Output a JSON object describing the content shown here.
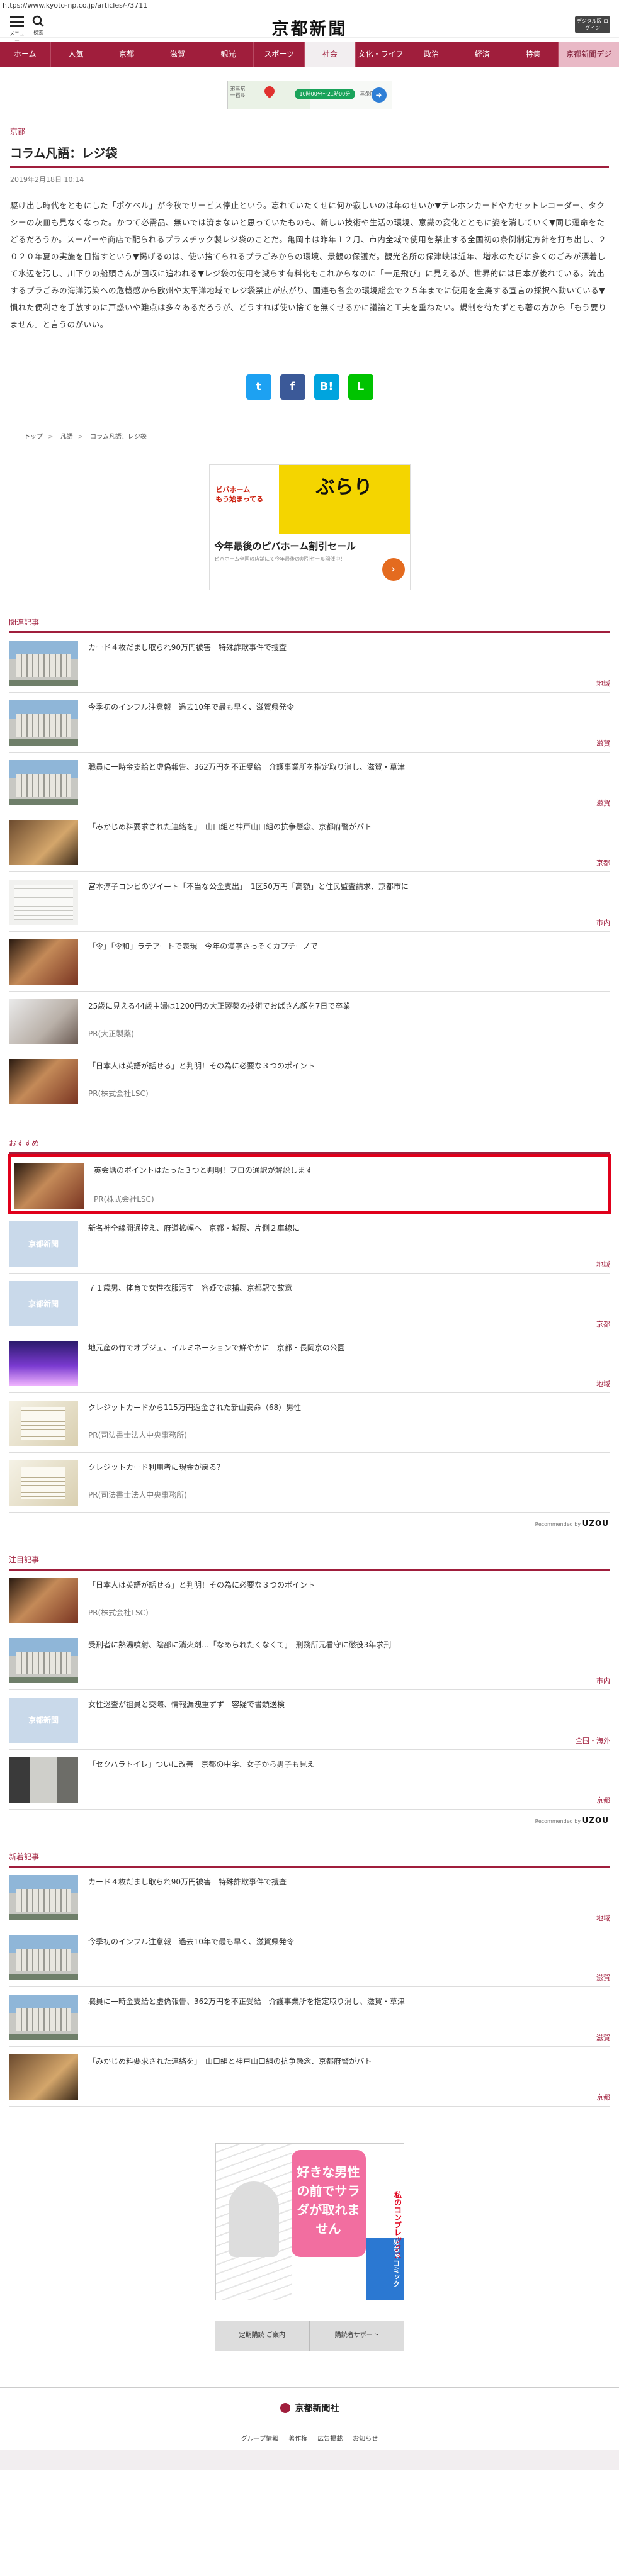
{
  "browser": {
    "url": "https://www.kyoto-np.co.jp/articles/-/3711"
  },
  "header": {
    "menu_label": "メニュー",
    "search_label": "検索",
    "logo": "京都新聞",
    "digital_label": "デジタル版 ログイン"
  },
  "nav": [
    "ホーム",
    "人気",
    "京都",
    "滋賀",
    "観光",
    "スポーツ",
    "社会",
    "文化・ライフ",
    "政治",
    "経済",
    "特集",
    "京都新聞デジ"
  ],
  "nav_active": "社会",
  "top_ad": {
    "map_text": "第三京\n一石ル",
    "pill": "10時00分〜21時00分",
    "dest": "三条店"
  },
  "article": {
    "category": "京都",
    "title": "コラム凡語：レジ袋",
    "date": "2019年2月18日 10:14",
    "body": "駆け出し時代をともにした「ポケベル」が今秋でサービス停止という。忘れていたくせに何か寂しいのは年のせいか▼テレホンカードやカセットレコーダー、タクシーの灰皿も見なくなった。かつて必需品、無いでは済まないと思っていたものも、新しい技術や生活の環境、意識の変化とともに姿を消していく▼同じ運命をたどるだろうか。スーパーや商店で配られるプラスチック製レジ袋のことだ。亀岡市は昨年１２月、市内全域で使用を禁止する全国初の条例制定方針を打ち出し、２０２０年夏の実施を目指すという▼掲げるのは、使い捨てられるプラごみからの環境、景観の保護だ。観光名所の保津峡は近年、増水のたびに多くのごみが漂着して水辺を汚し、川下りの船頭さんが回収に追われる▼レジ袋の使用を減らす有料化もこれからなのに「一足飛び」に見えるが、世界的には日本が後れている。流出するプラごみの海洋汚染への危機感から欧州や太平洋地域でレジ袋禁止が広がり、国連も各会の環境総会で２５年までに使用を全廃する宣言の採択へ動いている▼慣れた便利さを手放すのに戸惑いや難点は多々あるだろうが、どうすれば使い捨てを無くせるかに議論と工夫を重ねたい。規制を待たずとも著の方から「もう要りません」と言うのがいい。"
  },
  "share": [
    "twitter",
    "facebook",
    "hatena",
    "line"
  ],
  "breadcrumb": [
    "トップ",
    "凡語",
    "コラム凡語：レジ袋"
  ],
  "mid_ad": {
    "left": "ピバホーム\nもう始まってる",
    "main": "ぶらり",
    "headline": "今年最後のピバホーム割引セール",
    "sub": "ピバホーム全国の店舗にて今年最後の割引セール開催中！"
  },
  "related": {
    "heading": "関連記事",
    "items": [
      {
        "title": "カード４枚だまし取られ90万円被害　特殊詐欺事件で捜査",
        "sub": "",
        "cat": "地域"
      },
      {
        "title": "今季初のインフル注意報　過去10年で最も早く、滋賀県発令",
        "sub": "",
        "cat": "滋賀"
      },
      {
        "title": "職員に一時金支給と虚偽報告、362万円を不正受給　介護事業所を指定取り消し、滋賀・草津",
        "sub": "",
        "cat": "滋賀"
      },
      {
        "title": "「みかじめ料要求された連絡を」　山口組と神戸山口組の抗争懸念、京都府警がパト",
        "sub": "",
        "cat": "京都"
      },
      {
        "title": "宮本淳子コンビのツイート「不当な公金支出」　1区50万円「高額」と住民監査請求、京都市に",
        "sub": "",
        "cat": "市内"
      },
      {
        "title": "「令」「令和」ラテアートで表現　今年の漢字さっそくカプチーノで",
        "sub": "",
        "cat": ""
      },
      {
        "title": "25歳に見える44歳主婦は1200円の大正製薬の技術でおばさん顔を7日で卒業",
        "sub": "PR(大正製薬)",
        "cat": ""
      },
      {
        "title": "「日本人は英語が話せる」と判明！その為に必要な３つのポイント",
        "sub": "PR(株式会社LSC)",
        "cat": ""
      }
    ]
  },
  "recommend": {
    "heading": "おすすめ",
    "items": [
      {
        "title": "英会話のポイントはたった３つと判明！プロの通訳が解説します",
        "sub": "PR(株式会社LSC)",
        "cat": ""
      },
      {
        "title": "新名神全線開通控え、府道拡幅へ　京都・城陽、片側２車線に",
        "sub": "",
        "cat": "地域"
      },
      {
        "title": "７１歳男、体育で女性衣服汚す　容疑で逮捕、京都駅で故意",
        "sub": "",
        "cat": "京都"
      },
      {
        "title": "地元産の竹でオブジェ、イルミネーションで鮮やかに　京都・長岡京の公園",
        "sub": "",
        "cat": "地域"
      },
      {
        "title": "クレジットカードから115万円返金された新山安命（68）男性",
        "sub": "PR(司法書士法人中央事務所)",
        "cat": ""
      },
      {
        "title": "クレジットカード利用者に現金が戻る？",
        "sub": "PR(司法書士法人中央事務所)",
        "cat": ""
      }
    ],
    "by": "Recommended by",
    "brand": "UZOU"
  },
  "attention": {
    "heading": "注目記事",
    "items": [
      {
        "title": "「日本人は英語が話せる」と判明！その為に必要な３つのポイント",
        "sub": "PR(株式会社LSC)",
        "cat": ""
      },
      {
        "title": "受刑者に熱湯噴射、陰部に消火剤…「なめられたくなくて」　刑務所元看守に懲役3年求刑",
        "sub": "",
        "cat": "市内"
      },
      {
        "title": "女性巡査が祖員と交際、情報漏洩重ずず　容疑で書類送検",
        "sub": "",
        "cat": "全国・海外"
      },
      {
        "title": "「セクハラトイレ」ついに改善　京都の中学、女子から男子も見え",
        "sub": "",
        "cat": "京都"
      }
    ],
    "by": "Recommended by",
    "brand": "UZOU"
  },
  "latest": {
    "heading": "新着記事",
    "items": [
      {
        "title": "カード４枚だまし取られ90万円被害　特殊詐欺事件で捜査",
        "sub": "",
        "cat": "地域"
      },
      {
        "title": "今季初のインフル注意報　過去10年で最も早く、滋賀県発令",
        "sub": "",
        "cat": "滋賀"
      },
      {
        "title": "職員に一時金支給と虚偽報告、362万円を不正受給　介護事業所を指定取り消し、滋賀・草津",
        "sub": "",
        "cat": "滋賀"
      },
      {
        "title": "「みかじめ料要求された連絡を」　山口組と神戸山口組の抗争懸念、京都府警がパト",
        "sub": "",
        "cat": "京都"
      }
    ]
  },
  "manga_ad": {
    "center": "好きな男性の前でサラダが取れません",
    "right": "私のコンプレックス",
    "cm": "めちゃコミック"
  },
  "sub_buttons": [
    "定期購読 ご案内",
    "購読者サポート"
  ],
  "footer": {
    "logo": "京都新聞社",
    "links": [
      "グループ情報",
      "著作権",
      "広告掲載",
      "お知らせ"
    ]
  }
}
